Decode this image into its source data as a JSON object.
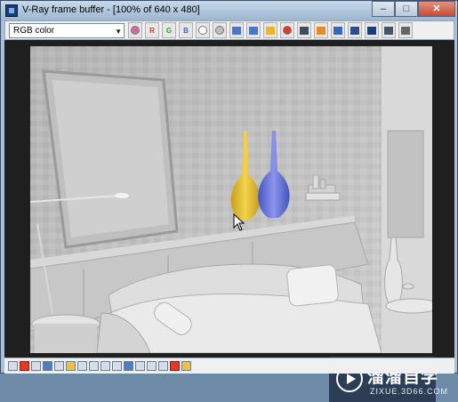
{
  "window": {
    "title": "V-Ray frame buffer - [100% of 640 x 480]",
    "buttons": {
      "minimize": "–",
      "maximize": "□",
      "close": "✕"
    }
  },
  "toolbar": {
    "channel_select": "RGB color",
    "tools": [
      {
        "name": "color-wheel-icon",
        "glyph": "",
        "color": "#d36aa6"
      },
      {
        "name": "red-channel-icon",
        "glyph": "R",
        "color": "#d1392c"
      },
      {
        "name": "green-channel-icon",
        "glyph": "G",
        "color": "#2e9b3a"
      },
      {
        "name": "blue-channel-icon",
        "glyph": "B",
        "color": "#3a5bd1"
      },
      {
        "name": "white-circle-icon",
        "glyph": "",
        "color": "#ffffff"
      },
      {
        "name": "gray-circle-icon",
        "glyph": "",
        "color": "#bcbcbc"
      },
      {
        "name": "save-icon",
        "glyph": "",
        "color": "#4b76c8"
      },
      {
        "name": "copy-icon",
        "glyph": "",
        "color": "#4b76c8"
      },
      {
        "name": "folder-icon",
        "glyph": "",
        "color": "#e9b533"
      },
      {
        "name": "stop-icon",
        "glyph": "",
        "color": "#e23a2a"
      },
      {
        "name": "region-render-icon",
        "glyph": "",
        "color": "#3c4c5c"
      },
      {
        "name": "track-mouse-icon",
        "glyph": "",
        "color": "#e08b2c"
      },
      {
        "name": "history-icon",
        "glyph": "",
        "color": "#3b68b6"
      },
      {
        "name": "lens-effects-icon",
        "glyph": "",
        "color": "#2f4f86"
      },
      {
        "name": "display-icon",
        "glyph": "",
        "color": "#1b3d7a"
      },
      {
        "name": "pixel-info-icon",
        "glyph": "",
        "color": "#445566"
      },
      {
        "name": "settings-icon",
        "glyph": "",
        "color": "#666666"
      }
    ]
  },
  "statusbar": {
    "icons": [
      "",
      "red",
      "",
      "blue",
      "",
      "yellow",
      "",
      "",
      "",
      "",
      "blue",
      "",
      "",
      "",
      "red",
      "yellow"
    ]
  },
  "watermark": {
    "title": "溜溜自学",
    "subtitle": "ZIXUE.3D66.COM"
  },
  "colors": {
    "vase_yellow": "#e7c23a",
    "vase_blue": "#6775d6"
  }
}
